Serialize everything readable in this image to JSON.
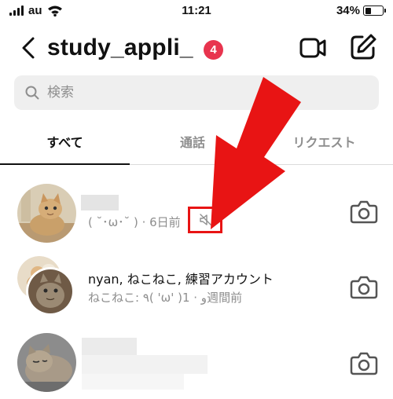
{
  "status_bar": {
    "carrier": "au",
    "time": "11:21",
    "battery": "34%",
    "battery_level": 0.34
  },
  "header": {
    "title": "study_appli_",
    "badge_count": "4",
    "back_icon": "chevron-left-icon",
    "video_icon": "video-camera-icon",
    "compose_icon": "compose-icon"
  },
  "search": {
    "placeholder": "検索",
    "icon": "search-icon"
  },
  "tabs": [
    {
      "label": "すべて",
      "active": true
    },
    {
      "label": "通話",
      "active": false
    },
    {
      "label": "リクエスト",
      "active": false
    }
  ],
  "conversations": [
    {
      "preview": "( ˘･ω･˘ ) · 6日前",
      "muted": true,
      "icon": "camera-icon"
    },
    {
      "name": "nyan, ねこねこ, 練習アカウント",
      "preview": "ねこねこ: ٩( 'ω' )و · 1週間前",
      "icon": "camera-icon"
    },
    {
      "icon": "camera-icon"
    }
  ],
  "annotation": {
    "color": "#e81414"
  },
  "colors": {
    "badge": "#e8344e",
    "muted_text": "#8e8e8e",
    "search_bg": "#efefef"
  }
}
